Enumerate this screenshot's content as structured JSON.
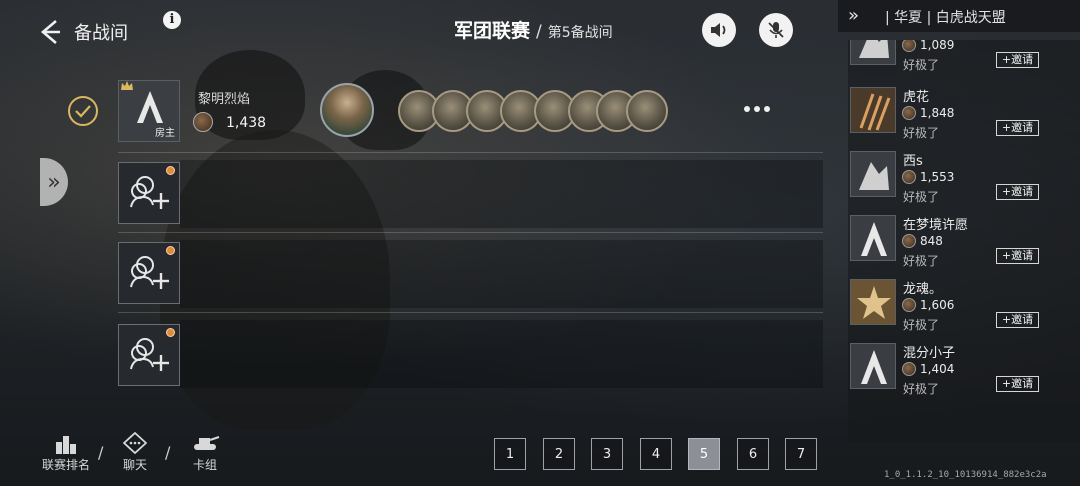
{
  "header": {
    "back_label": "备战间",
    "title": "军团联赛",
    "separator": "/",
    "subtitle": "第5备战间"
  },
  "host": {
    "name": "黎明烈焰",
    "score": "1,438",
    "role_tag": "房主"
  },
  "right_panel": {
    "title": "| 华夏 | 白虎战天盟",
    "friends": [
      {
        "name": "",
        "score": "1,089",
        "status": "好极了",
        "invite": "+邀请",
        "avatar": "wolf-emblem"
      },
      {
        "name": "虎花",
        "score": "1,848",
        "status": "好极了",
        "invite": "+邀请",
        "avatar": "claw-marks"
      },
      {
        "name": "西s",
        "score": "1,553",
        "status": "好极了",
        "invite": "+邀请",
        "avatar": "wolf-emblem"
      },
      {
        "name": "在梦境许愿",
        "score": "848",
        "status": "好极了",
        "invite": "+邀请",
        "avatar": "default-emblem"
      },
      {
        "name": "龙魂。",
        "score": "1,606",
        "status": "好极了",
        "invite": "+邀请",
        "avatar": "star-emblem"
      },
      {
        "name": "混分小子",
        "score": "1,404",
        "status": "好极了",
        "invite": "+邀请",
        "avatar": "default-emblem"
      }
    ]
  },
  "bottom_nav": {
    "items": [
      {
        "label": "联赛排名",
        "icon": "ranking-icon"
      },
      {
        "label": "聊天",
        "icon": "chat-icon"
      },
      {
        "label": "卡组",
        "icon": "tank-icon"
      }
    ],
    "separator": "/"
  },
  "pagination": {
    "pages": [
      "1",
      "2",
      "3",
      "4",
      "5",
      "6",
      "7"
    ],
    "active": "5"
  },
  "version": "1_0_1.1.2_10_10136914_882e3c2a",
  "colors": {
    "accent_gold": "#d9b860",
    "invite_dot": "#e08a3c",
    "active_page": "#8c9096"
  }
}
